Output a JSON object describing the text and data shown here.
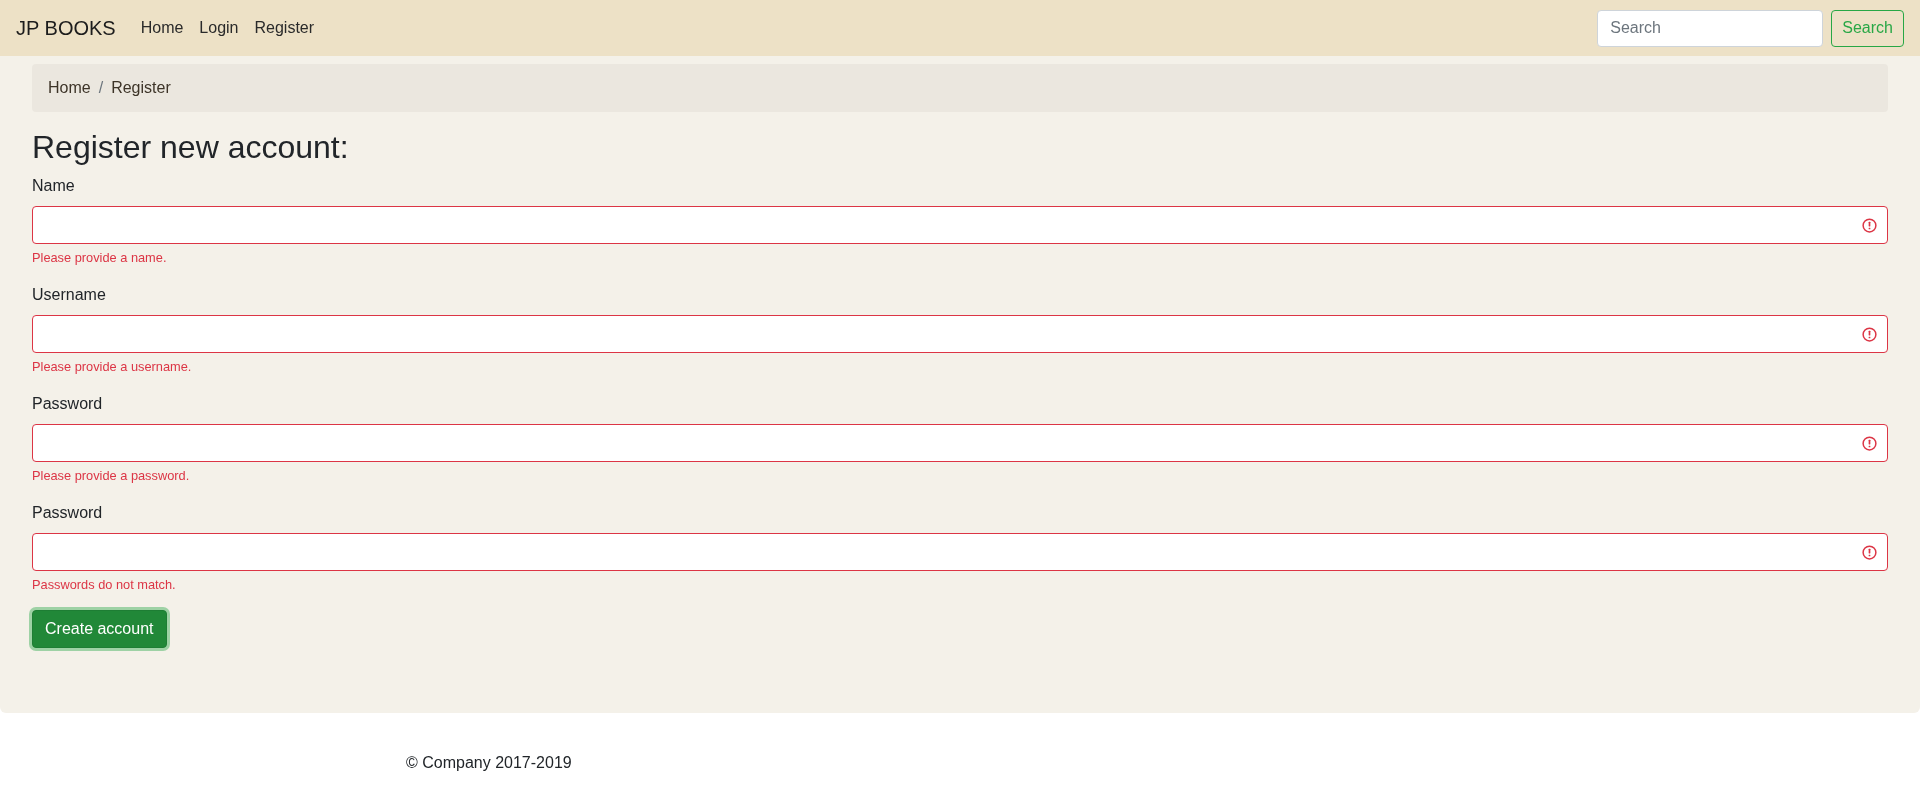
{
  "navbar": {
    "brand": "JP BOOKS",
    "links": [
      {
        "label": "Home"
      },
      {
        "label": "Login"
      },
      {
        "label": "Register"
      }
    ],
    "search": {
      "placeholder": "Search",
      "button": "Search"
    }
  },
  "breadcrumb": {
    "items": [
      {
        "label": "Home"
      },
      {
        "label": "Register"
      }
    ],
    "separator": "/"
  },
  "heading": "Register new account:",
  "fields": [
    {
      "label": "Name",
      "invalid": true,
      "error": "Please provide a name."
    },
    {
      "label": "Username",
      "invalid": true,
      "error": "Please provide a username."
    },
    {
      "label": "Password",
      "invalid": true,
      "error": "Please provide a password."
    },
    {
      "label": "Password",
      "invalid": true,
      "error": "Passwords do not match."
    }
  ],
  "submit": {
    "label": "Create account",
    "focused": true
  },
  "footer": "© Company 2017-2019"
}
